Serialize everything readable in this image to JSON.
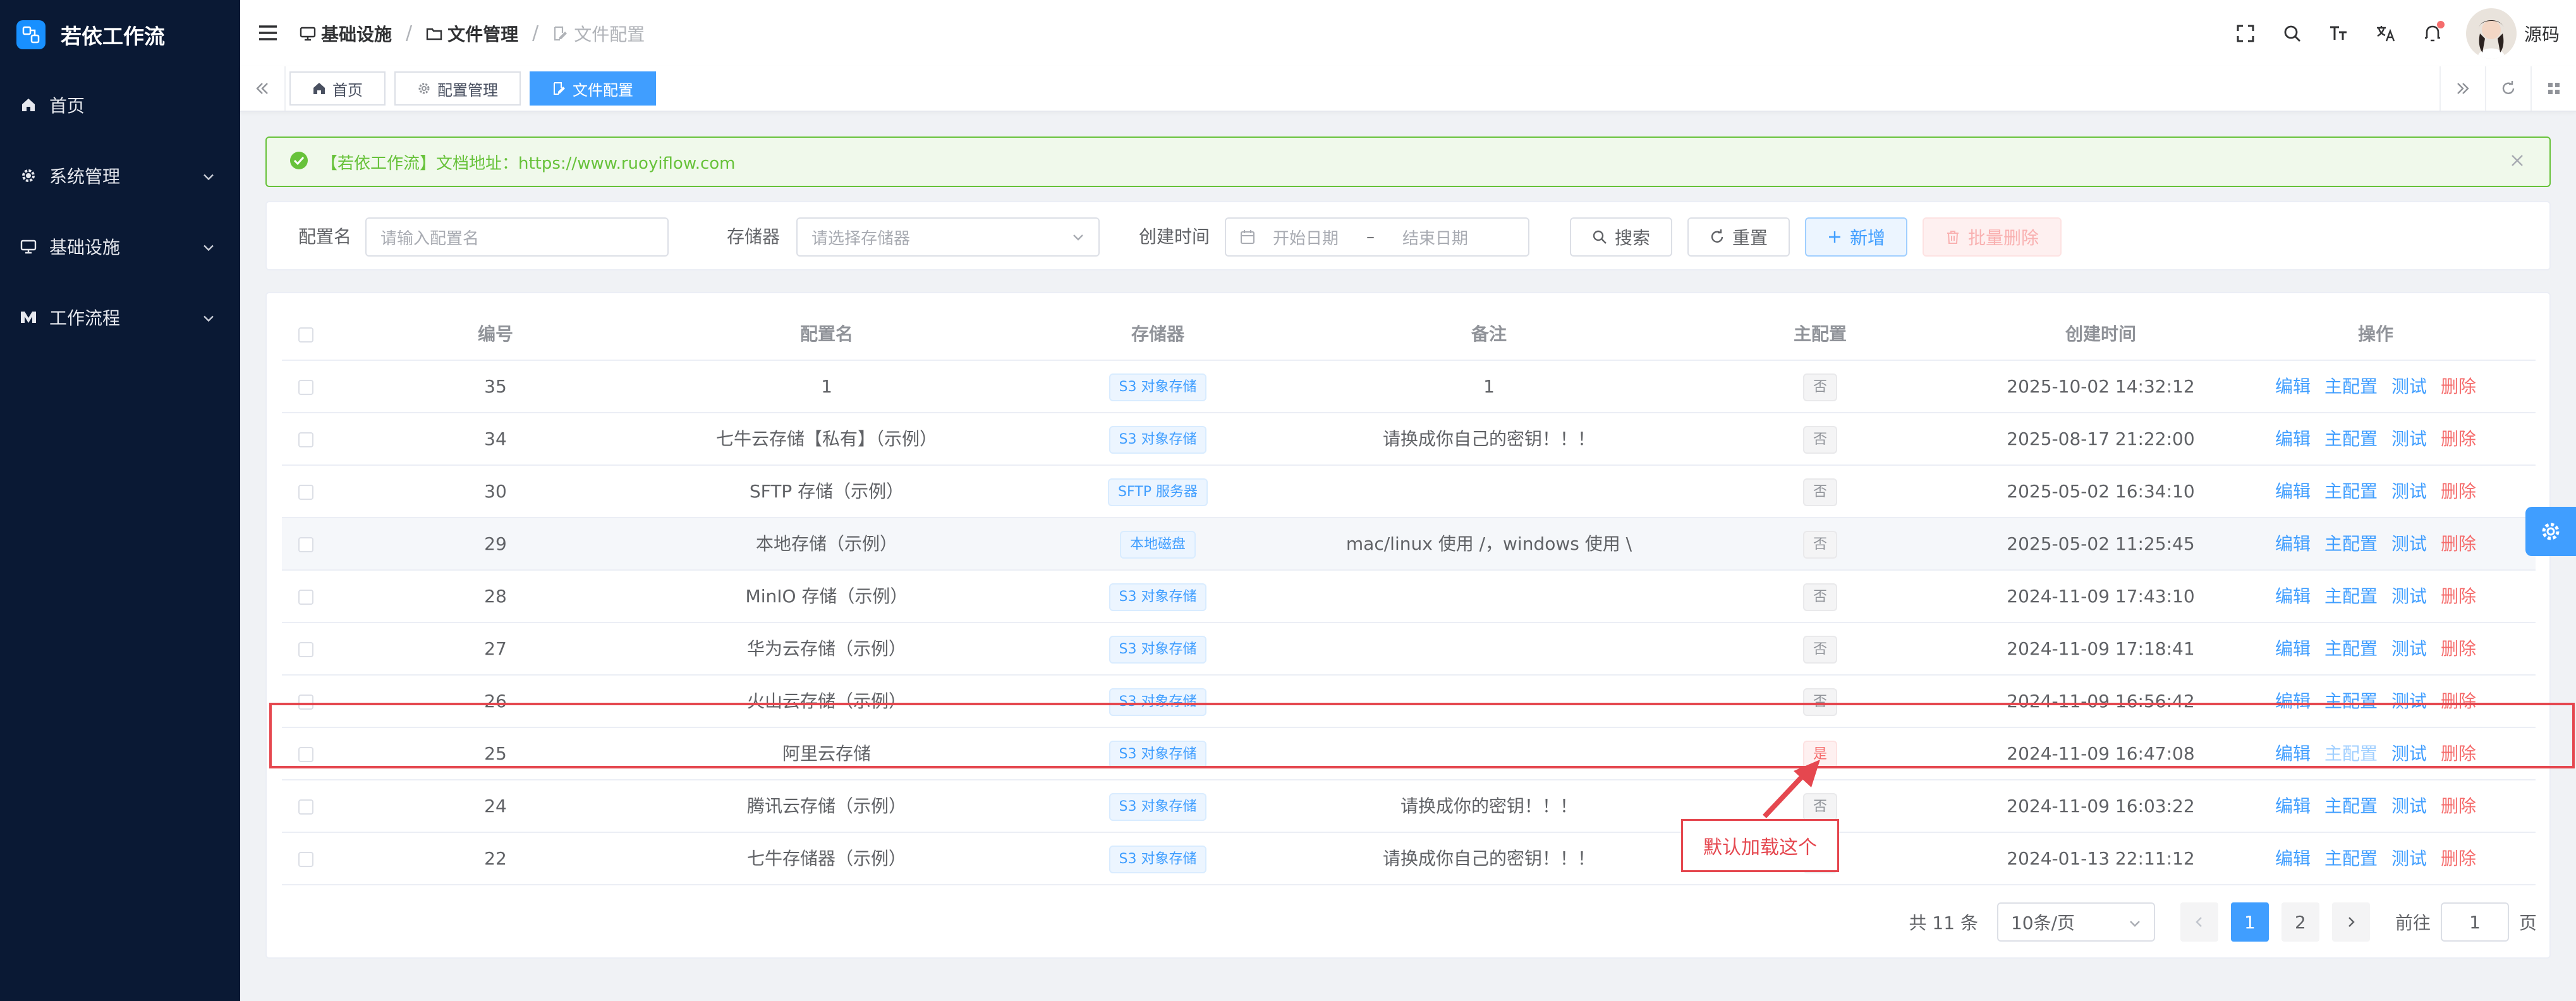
{
  "app": {
    "title": "若依工作流"
  },
  "sidebar": {
    "items": [
      {
        "label": "首页",
        "icon": "home-icon"
      },
      {
        "label": "系统管理",
        "icon": "gear-icon"
      },
      {
        "label": "基础设施",
        "icon": "monitor-icon"
      },
      {
        "label": "工作流程",
        "icon": "workflow-icon"
      }
    ]
  },
  "header": {
    "breadcrumb": [
      "基础设施",
      "文件管理",
      "文件配置"
    ],
    "user_name": "源码"
  },
  "tabs": [
    {
      "label": "首页"
    },
    {
      "label": "配置管理"
    },
    {
      "label": "文件配置"
    }
  ],
  "alert": {
    "text": "【若依工作流】文档地址：https://www.ruoyiflow.com"
  },
  "search": {
    "name_label": "配置名",
    "name_placeholder": "请输入配置名",
    "storage_label": "存储器",
    "storage_placeholder": "请选择存储器",
    "time_label": "创建时间",
    "start_placeholder": "开始日期",
    "range_sep": "–",
    "end_placeholder": "结束日期",
    "search_btn": "搜索",
    "reset_btn": "重置",
    "add_btn": "新增",
    "batch_delete_btn": "批量删除"
  },
  "table": {
    "columns": [
      "编号",
      "配置名",
      "存储器",
      "备注",
      "主配置",
      "创建时间",
      "操作"
    ],
    "actions": {
      "edit": "编辑",
      "master": "主配置",
      "test": "测试",
      "delete": "删除"
    },
    "rows": [
      {
        "id": "35",
        "name": "1",
        "storage": "S3 对象存储",
        "remark": "1",
        "master": "否",
        "created": "2025-10-02 14:32:12"
      },
      {
        "id": "34",
        "name": "七牛云存储【私有】（示例）",
        "storage": "S3 对象存储",
        "remark": "请换成你自己的密钥！！！",
        "master": "否",
        "created": "2025-08-17 21:22:00"
      },
      {
        "id": "30",
        "name": "SFTP 存储（示例）",
        "storage": "SFTP 服务器",
        "remark": "",
        "master": "否",
        "created": "2025-05-02 16:34:10"
      },
      {
        "id": "29",
        "name": "本地存储（示例）",
        "storage": "本地磁盘",
        "remark": "mac/linux 使用 /，windows 使用 \\",
        "master": "否",
        "created": "2025-05-02 11:25:45"
      },
      {
        "id": "28",
        "name": "MinIO 存储（示例）",
        "storage": "S3 对象存储",
        "remark": "",
        "master": "否",
        "created": "2024-11-09 17:43:10"
      },
      {
        "id": "27",
        "name": "华为云存储（示例）",
        "storage": "S3 对象存储",
        "remark": "",
        "master": "否",
        "created": "2024-11-09 17:18:41"
      },
      {
        "id": "26",
        "name": "火山云存储（示例）",
        "storage": "S3 对象存储",
        "remark": "",
        "master": "否",
        "created": "2024-11-09 16:56:42"
      },
      {
        "id": "25",
        "name": "阿里云存储",
        "storage": "S3 对象存储",
        "remark": "",
        "master": "是",
        "created": "2024-11-09 16:47:08"
      },
      {
        "id": "24",
        "name": "腾讯云存储（示例）",
        "storage": "S3 对象存储",
        "remark": "请换成你的密钥！！！",
        "master": "否",
        "created": "2024-11-09 16:03:22"
      },
      {
        "id": "22",
        "name": "七牛存储器（示例）",
        "storage": "S3 对象存储",
        "remark": "请换成你自己的密钥！！！",
        "master": "否",
        "created": "2024-01-13 22:11:12"
      }
    ]
  },
  "pagination": {
    "total": "共 11 条",
    "page_size": "10条/页",
    "pages": [
      "1",
      "2"
    ],
    "goto_label": "前往",
    "goto_value": "1",
    "page_suffix": "页"
  },
  "annotation": {
    "text": "默认加载这个"
  },
  "colors": {
    "primary": "#409eff",
    "sidebar_bg": "#0a1934",
    "success": "#67c23a",
    "danger": "#f56c6c",
    "annotation": "#e5474f"
  }
}
